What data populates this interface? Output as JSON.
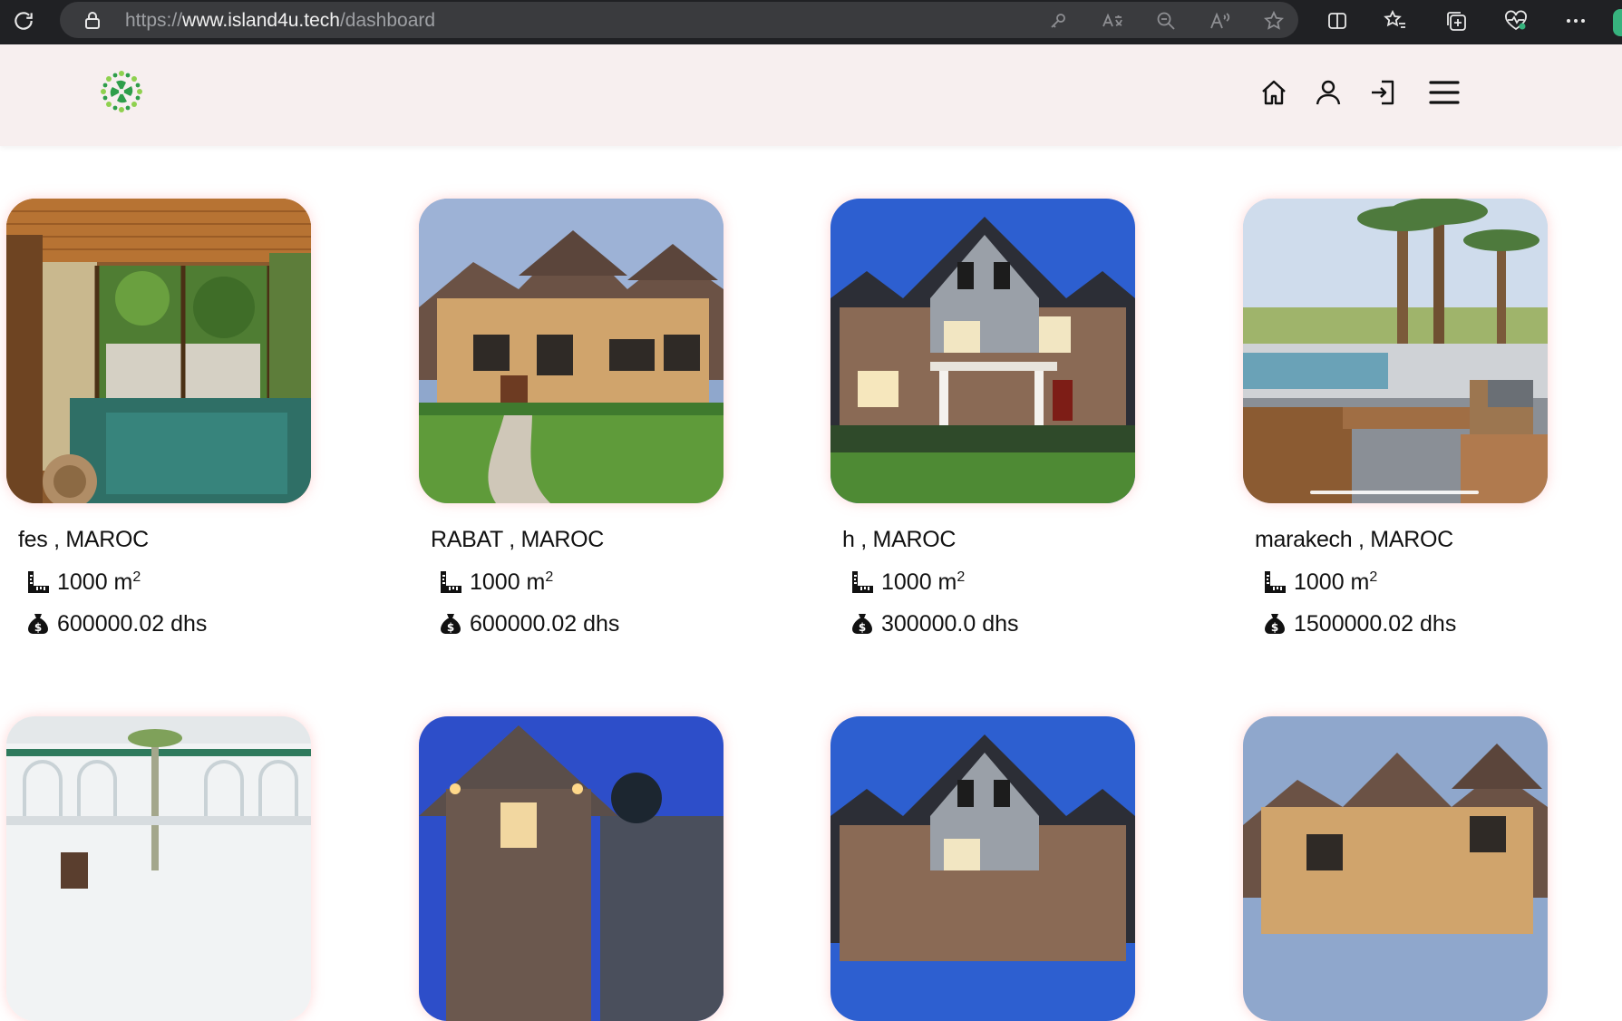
{
  "browser": {
    "url_scheme": "https://",
    "url_host": "www.island4u.tech",
    "url_path": "/dashboard"
  },
  "header": {
    "nav": [
      "home-icon",
      "user-icon",
      "login-icon",
      "menu-icon"
    ]
  },
  "colors": {
    "header_bg": "#f7efef",
    "browser_bg": "#202124",
    "logo_green": "#2e9e4a"
  },
  "cards": [
    {
      "title": "fes , MAROC",
      "area": "1000 m",
      "area_unit_sup": "2",
      "price": "600000.02 dhs"
    },
    {
      "title": "RABAT , MAROC",
      "area": "1000 m",
      "area_unit_sup": "2",
      "price": "600000.02 dhs"
    },
    {
      "title": "h , MAROC",
      "area": "1000 m",
      "area_unit_sup": "2",
      "price": "300000.0 dhs"
    },
    {
      "title": "marakech , MAROC",
      "area": "1000 m",
      "area_unit_sup": "2",
      "price": "1500000.02 dhs"
    }
  ]
}
